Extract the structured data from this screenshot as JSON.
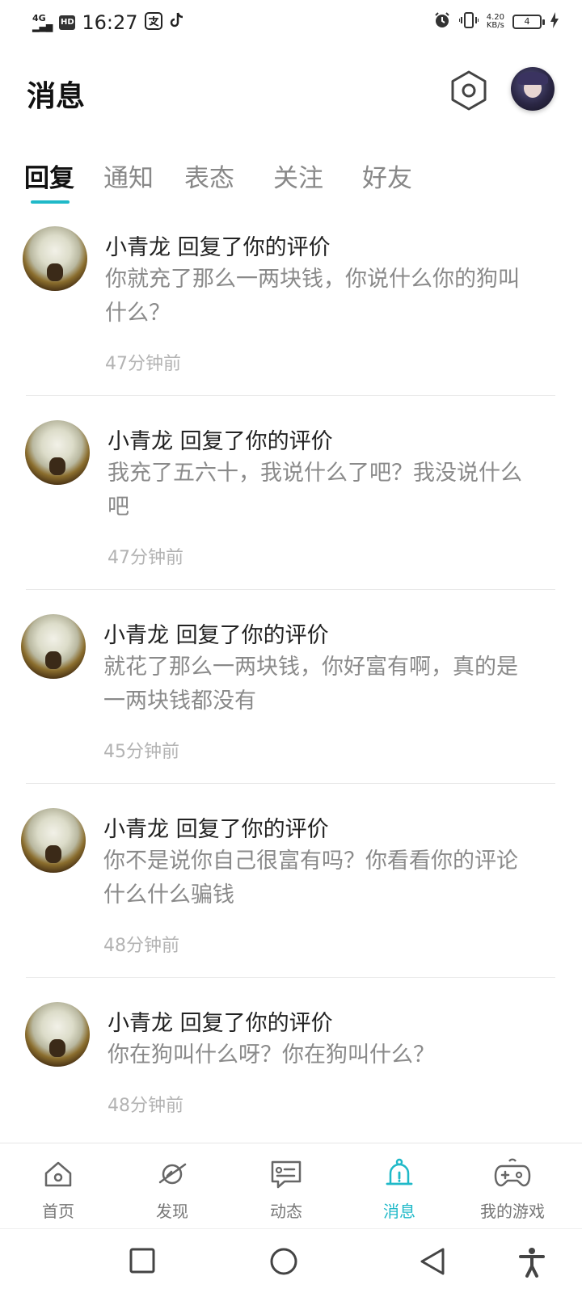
{
  "status_bar": {
    "network": "4G",
    "hd": "HD",
    "time": "16:27",
    "speed": "4.20",
    "speed_unit": "KB/s",
    "battery": "4"
  },
  "header": {
    "title": "消息"
  },
  "tabs": [
    {
      "label": "回复",
      "active": true
    },
    {
      "label": "通知",
      "active": false
    },
    {
      "label": "表态",
      "active": false
    },
    {
      "label": "关注",
      "active": false
    },
    {
      "label": "好友",
      "active": false
    }
  ],
  "messages": [
    {
      "title": "小青龙 回复了你的评价",
      "line1": "你就充了那么一两块钱，你说什么你的狗叫",
      "line2": "什么？",
      "time": "47分钟前"
    },
    {
      "title": "小青龙 回复了你的评价",
      "line1": "我充了五六十，我说什么了吧？我没说什么",
      "line2": "吧",
      "time": "47分钟前"
    },
    {
      "title": "小青龙 回复了你的评价",
      "line1": "就花了那么一两块钱，你好富有啊，真的是",
      "line2": "一两块钱都没有",
      "time": "45分钟前"
    },
    {
      "title": "小青龙 回复了你的评价",
      "line1": "你不是说你自己很富有吗？你看看你的评论",
      "line2": "什么什么骗钱",
      "time": "48分钟前"
    },
    {
      "title": "小青龙 回复了你的评价",
      "line1": "你在狗叫什么呀？你在狗叫什么？",
      "line2": "",
      "time": "48分钟前"
    }
  ],
  "bottom_nav": [
    {
      "label": "首页",
      "icon": "home-icon",
      "active": false
    },
    {
      "label": "发现",
      "icon": "planet-icon",
      "active": false
    },
    {
      "label": "动态",
      "icon": "chat-icon",
      "active": false
    },
    {
      "label": "消息",
      "icon": "bell-icon",
      "active": true
    },
    {
      "label": "我的游戏",
      "icon": "gamepad-icon",
      "active": false
    }
  ],
  "colors": {
    "accent": "#1fb9c8",
    "text_primary": "#222222",
    "text_secondary": "#8a8a8a",
    "text_time": "#b3b3b3"
  }
}
